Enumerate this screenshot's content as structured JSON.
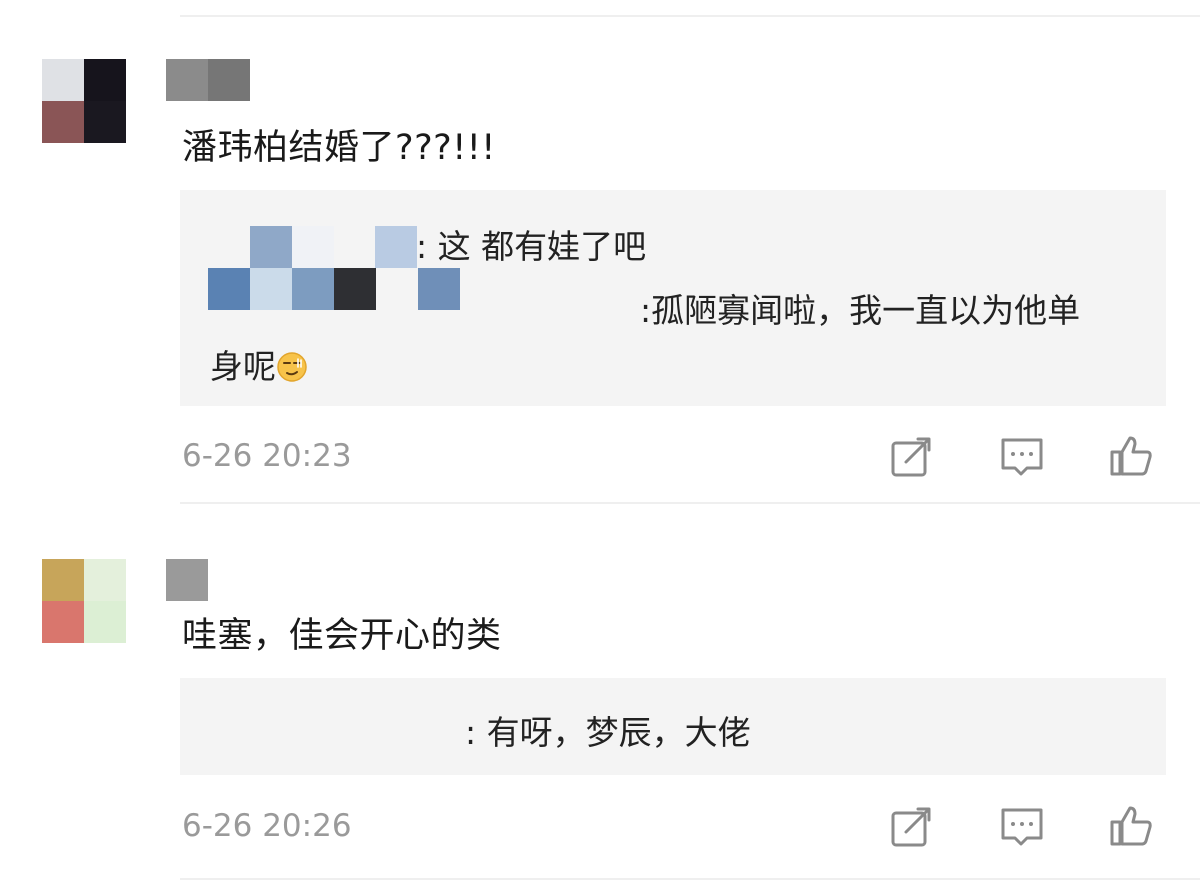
{
  "comments": [
    {
      "text": "潘玮柏结婚了???!!!",
      "replies": [
        {
          "text": ": 这  都有娃了吧"
        },
        {
          "text": ":孤陋寡闻啦，我一直以为他单",
          "continuation": "身呢"
        }
      ],
      "timestamp": "6-26 20:23",
      "emoji_icon": "smirk-face-icon"
    },
    {
      "text": "哇塞，佳会开心的类",
      "replies": [
        {
          "text": ": 有呀，梦辰，大佬"
        }
      ],
      "timestamp": "6-26 20:26"
    }
  ],
  "actions": [
    "share-icon",
    "comment-icon",
    "like-icon"
  ],
  "colors": {
    "divider": "#efefef",
    "reply_bg": "#f4f4f4",
    "meta": "#9a9a9a",
    "icon": "#8a8a8a"
  }
}
